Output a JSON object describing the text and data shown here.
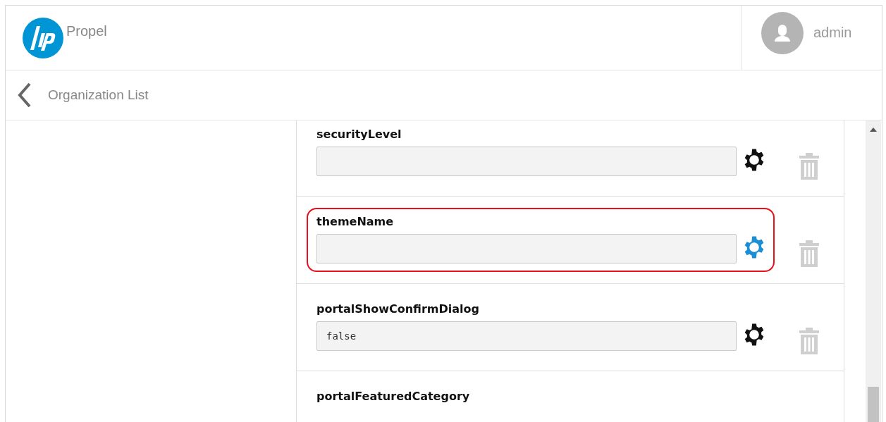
{
  "header": {
    "app_name": "Propel",
    "user": {
      "name": "admin"
    }
  },
  "breadcrumb": {
    "label": "Organization List"
  },
  "properties": [
    {
      "name": "securityLevel",
      "highlighted": false,
      "gear_selected": false
    },
    {
      "name": "themeName",
      "highlighted": true,
      "gear_selected": true
    },
    {
      "name": "portalShowConfirmDialog",
      "value": "false",
      "highlighted": false,
      "gear_selected": false
    },
    {
      "name": "portalFeaturedCategory"
    }
  ]
}
